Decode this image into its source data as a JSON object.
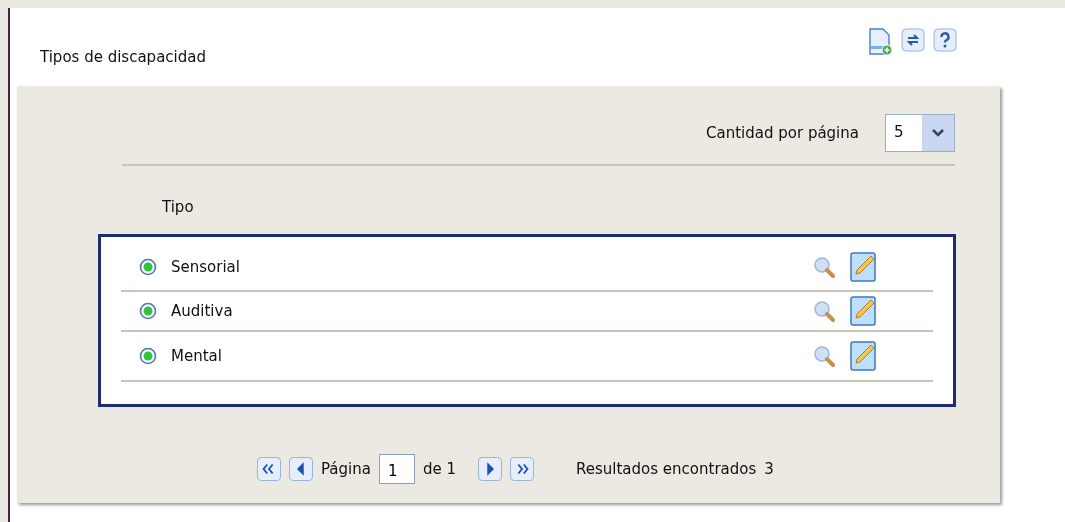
{
  "title": "Tipos de discapacidad",
  "toolbar": [
    {
      "kind": "new"
    },
    {
      "kind": "refresh"
    },
    {
      "kind": "help"
    }
  ],
  "page_size": {
    "label": "Cantidad por página",
    "value": "5"
  },
  "table": {
    "columns": [
      "Tipo"
    ],
    "rows": [
      {
        "name": "Sensorial",
        "active": true
      },
      {
        "name": "Auditiva",
        "active": true
      },
      {
        "name": "Mental",
        "active": true
      }
    ]
  },
  "pagination": {
    "label": "Página",
    "page": "1",
    "of": "de 1",
    "results_label": "Resultados encontrados",
    "results": "3"
  }
}
